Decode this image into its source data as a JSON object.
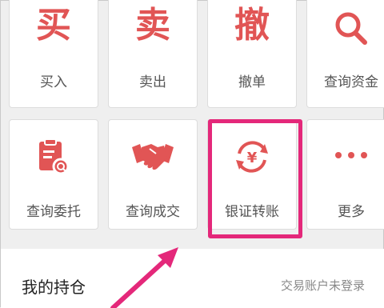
{
  "grid": {
    "row1": [
      {
        "glyph": "买",
        "label": "买入"
      },
      {
        "glyph": "卖",
        "label": "卖出"
      },
      {
        "glyph": "撤",
        "label": "撤单"
      },
      {
        "icon": "search-icon",
        "label": "查询资金"
      }
    ],
    "row2": [
      {
        "icon": "clipboard-search-icon",
        "label": "查询委托"
      },
      {
        "icon": "handshake-icon",
        "label": "查询成交"
      },
      {
        "icon": "yen-transfer-icon",
        "label": "银证转账"
      },
      {
        "icon": "more-dots-icon",
        "label": "更多"
      }
    ]
  },
  "holdings": {
    "title": "我的持仓",
    "status": "交易账户未登录"
  },
  "annotation": {
    "highlight_color": "#e4287a",
    "arrow_color": "#e4287a"
  },
  "colors": {
    "accent": "#e15555",
    "label": "#555555",
    "background": "#efefef"
  }
}
